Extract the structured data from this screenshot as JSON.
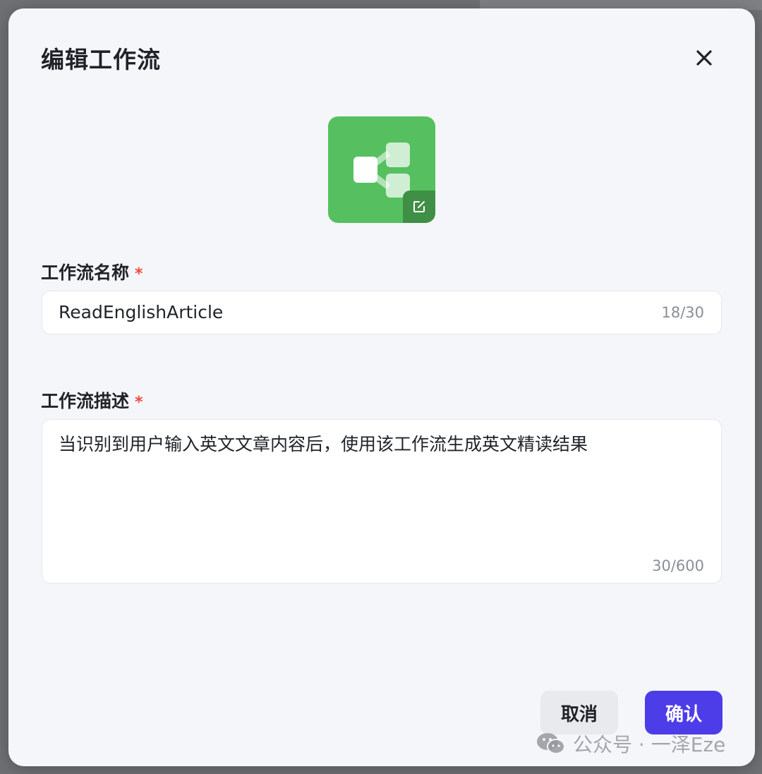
{
  "dialog": {
    "title": "编辑工作流",
    "close_icon": "close-icon"
  },
  "workflow_icon": {
    "icon": "workflow-icon",
    "edit_icon": "edit-icon",
    "tile_color": "#56c060"
  },
  "name_field": {
    "label": "工作流名称",
    "required_mark": "*",
    "value": "ReadEnglishArticle",
    "counter": "18/30"
  },
  "description_field": {
    "label": "工作流描述",
    "required_mark": "*",
    "value": "当识别到用户输入英文文章内容后，使用该工作流生成英文精读结果",
    "counter": "30/600"
  },
  "actions": {
    "cancel_label": "取消",
    "confirm_label": "确认",
    "confirm_color": "#4d3de8"
  },
  "watermark": {
    "text": "公众号 · 一泽Eze",
    "icon": "wechat-icon"
  }
}
